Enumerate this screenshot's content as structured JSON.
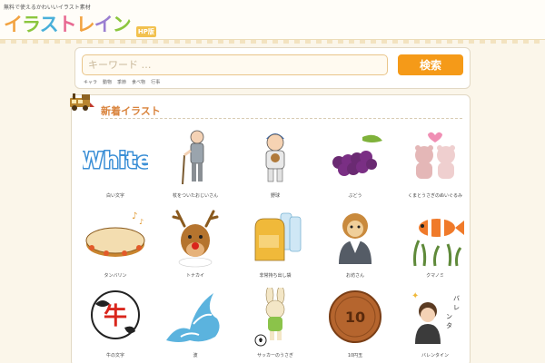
{
  "header": {
    "tagline": "無料で使えるかわいいイラスト素材",
    "logo_chars": [
      "イ",
      "ラ",
      "ス",
      "ト",
      "レ",
      "イ",
      "ン"
    ],
    "logo_badge": "HP版"
  },
  "search": {
    "placeholder": "キーワード …",
    "button_label": "検索",
    "keywords": [
      "キャラ",
      "動物",
      "季節",
      "食べ物",
      "行事"
    ]
  },
  "section": {
    "title": "新着イラスト"
  },
  "items": [
    {
      "caption": "白い文字",
      "icon": "white-text-icon"
    },
    {
      "caption": "杖をついたおじいさん",
      "icon": "old-man-icon"
    },
    {
      "caption": "野球",
      "icon": "baseball-boy-icon"
    },
    {
      "caption": "ぶどう",
      "icon": "grapes-icon"
    },
    {
      "caption": "くまとうさぎのぬいぐるみ",
      "icon": "plush-bears-icon"
    },
    {
      "caption": "タンバリン",
      "icon": "tambourine-icon"
    },
    {
      "caption": "トナカイ",
      "icon": "reindeer-icon"
    },
    {
      "caption": "非常持ち出し袋",
      "icon": "emergency-bag-icon"
    },
    {
      "caption": "お坊さん",
      "icon": "monkey-kimono-icon"
    },
    {
      "caption": "クマノミ",
      "icon": "clownfish-icon"
    },
    {
      "caption": "牛の文字",
      "icon": "cow-kanji-icon"
    },
    {
      "caption": "波",
      "icon": "wave-icon"
    },
    {
      "caption": "サッカーのうさぎ",
      "icon": "rabbit-soccer-icon"
    },
    {
      "caption": "10円玉",
      "icon": "coin-icon"
    },
    {
      "caption": "バレンタイン",
      "icon": "valentine-boy-icon"
    }
  ]
}
